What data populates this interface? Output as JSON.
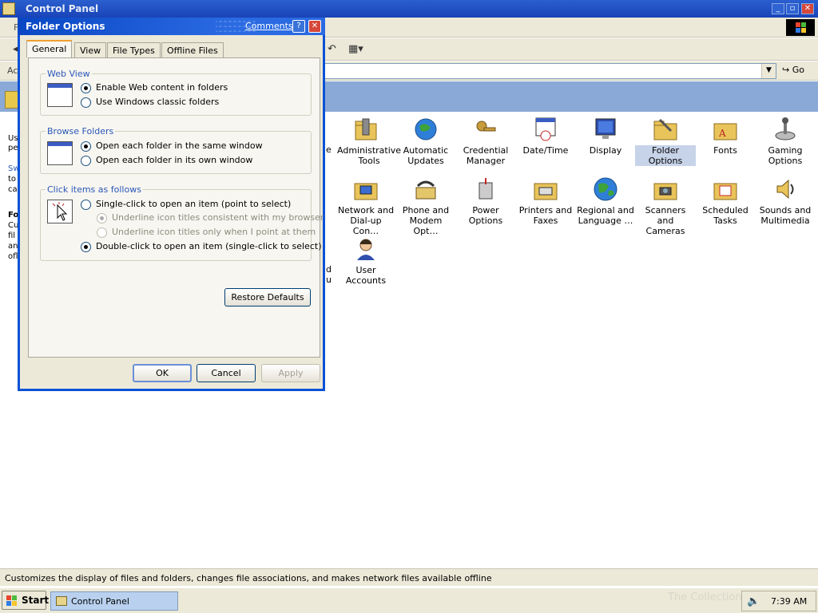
{
  "window": {
    "title": "Control Panel",
    "minimize": "_",
    "maximize": "▫",
    "close": "✕"
  },
  "menubar": {
    "partial_label": "F"
  },
  "toolbar": {
    "undo_icon": "undo-icon",
    "views_icon": "views-icon"
  },
  "address": {
    "label": "Ac",
    "go_label": "Go"
  },
  "side_pane": {
    "lines": [
      "Us",
      "pe",
      "Sw",
      "to",
      "ca",
      "Fo",
      "Cu",
      "fil",
      "an",
      "ofl"
    ]
  },
  "items": [
    {
      "label": "Administrative Tools",
      "icon": "administrative-tools-icon"
    },
    {
      "label": "Automatic Updates",
      "icon": "automatic-updates-icon"
    },
    {
      "label": "Credential Manager",
      "icon": "credential-manager-icon"
    },
    {
      "label": "Date/Time",
      "icon": "date-time-icon"
    },
    {
      "label": "Display",
      "icon": "display-icon"
    },
    {
      "label": "Folder Options",
      "icon": "folder-options-icon"
    },
    {
      "label": "Fonts",
      "icon": "fonts-icon"
    },
    {
      "label": "Gaming Options",
      "icon": "gaming-options-icon"
    },
    {
      "label": "Network and Dial-up Con…",
      "icon": "network-icon"
    },
    {
      "label": "Phone and Modem Opt…",
      "icon": "phone-modem-icon"
    },
    {
      "label": "Power Options",
      "icon": "power-options-icon"
    },
    {
      "label": "Printers and Faxes",
      "icon": "printers-faxes-icon"
    },
    {
      "label": "Regional and Language …",
      "icon": "regional-language-icon"
    },
    {
      "label": "Scanners and Cameras",
      "icon": "scanners-cameras-icon"
    },
    {
      "label": "Scheduled Tasks",
      "icon": "scheduled-tasks-icon"
    },
    {
      "label": "Sounds and Multimedia",
      "icon": "sounds-multimedia-icon"
    },
    {
      "label": "User Accounts",
      "icon": "user-accounts-icon"
    }
  ],
  "partial_column": {
    "letter_e": "e",
    "letter_d": "d",
    "letter_u": "u"
  },
  "status_bar": {
    "text": "Customizes the display of files and folders, changes file associations, and makes network files available offline"
  },
  "taskbar": {
    "start_label": "Start",
    "task_label": "Control Panel",
    "clock": "7:39 AM",
    "watermark": "The Collection Book"
  },
  "dialog": {
    "title": "Folder Options",
    "comments_link": "Comments?",
    "help": "?",
    "close": "✕",
    "tabs": [
      "General",
      "View",
      "File Types",
      "Offline Files"
    ],
    "active_tab": "General",
    "web_view": {
      "title": "Web View",
      "options": [
        "Enable Web content in folders",
        "Use Windows classic folders"
      ],
      "selected": 0
    },
    "browse_folders": {
      "title": "Browse Folders",
      "options": [
        "Open each folder in the same window",
        "Open each folder in its own window"
      ],
      "selected": 0
    },
    "click_items": {
      "title": "Click items as follows",
      "single_click": "Single-click to open an item (point to select)",
      "underline_browser": "Underline icon titles consistent with my browser",
      "underline_point": "Underline icon titles only when I point at them",
      "double_click": "Double-click to open an item (single-click to select)",
      "selected": "double_click"
    },
    "restore_defaults": "Restore Defaults",
    "ok": "OK",
    "cancel": "Cancel",
    "apply": "Apply"
  },
  "colors": {
    "titlebar": "#1944b8",
    "dialog_border": "#0b51d6",
    "header_band": "#8aa9d6",
    "group_title": "#2a57b8",
    "selected_item": "#c7d3e8"
  }
}
